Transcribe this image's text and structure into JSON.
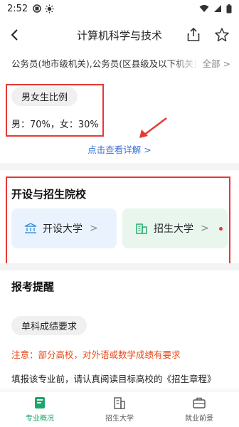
{
  "status_bar": {
    "time": "2:52"
  },
  "header": {
    "title": "计算机科学与技术"
  },
  "jobs": {
    "text": "公务员(地市级机关),公务员(区县级及以下机关),",
    "all_label": "全部 >"
  },
  "gender_ratio": {
    "pill": "男女生比例",
    "text": "男：70%，女：30%",
    "male_percent": 70,
    "female_percent": 30
  },
  "detail_link": "点击查看详解 >",
  "schools": {
    "title": "开设与招生院校",
    "kaishe_label": "开设大学",
    "zhaosheng_label": "招生大学",
    "chevron": ">"
  },
  "reminder": {
    "title": "报考提醒",
    "tip_pill": "单科成绩要求",
    "notice": "注意：部分高校，对外语或数学成绩有要求",
    "fill_note": "填报该专业前，请认真阅读目标高校的《招生章程》"
  },
  "bottom_nav": {
    "items": [
      {
        "label": "专业概况",
        "icon": "book-icon",
        "active": true
      },
      {
        "label": "招生大学",
        "icon": "school-icon",
        "active": false
      },
      {
        "label": "就业前景",
        "icon": "briefcase-icon",
        "active": false
      }
    ]
  },
  "colors": {
    "accent_green": "#1aa86a",
    "annotation_red": "#e53935",
    "link_blue": "#3a6fd8",
    "notice_orange": "#e64a19"
  }
}
